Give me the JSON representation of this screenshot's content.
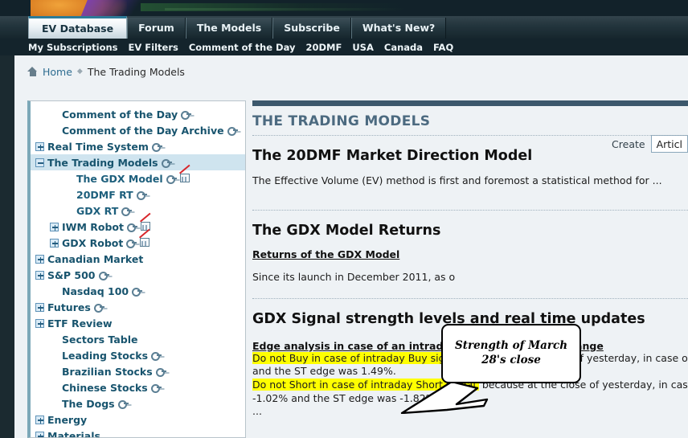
{
  "banner": {
    "name": "site-banner"
  },
  "tabs": [
    {
      "label": "EV Database",
      "active": true
    },
    {
      "label": "Forum",
      "active": false
    },
    {
      "label": "The Models",
      "active": false
    },
    {
      "label": "Subscribe",
      "active": false
    },
    {
      "label": "What's New?",
      "active": false
    }
  ],
  "subnav": [
    {
      "label": "My Subscriptions"
    },
    {
      "label": "EV Filters"
    },
    {
      "label": "Comment of the Day"
    },
    {
      "label": "20DMF"
    },
    {
      "label": "USA"
    },
    {
      "label": "Canada"
    },
    {
      "label": "FAQ"
    }
  ],
  "breadcrumb": {
    "home": "Home",
    "separator": "◆",
    "current": "The Trading Models"
  },
  "create_bar": {
    "label": "Create",
    "selected_option": "Articl"
  },
  "sidebar": {
    "items": [
      {
        "label": "Comment of the Day",
        "toggle": "none",
        "indent": 1,
        "key": true,
        "chart": false,
        "selected": false
      },
      {
        "label": "Comment of the Day Archive",
        "toggle": "none",
        "indent": 1,
        "key": true,
        "chart": false,
        "selected": false
      },
      {
        "label": "Real Time System",
        "toggle": "plus",
        "indent": 0,
        "key": true,
        "chart": false,
        "selected": false
      },
      {
        "label": "The Trading Models",
        "toggle": "minus",
        "indent": 0,
        "key": true,
        "chart": false,
        "selected": true
      },
      {
        "label": "The GDX Model",
        "toggle": "none",
        "indent": 2,
        "key": true,
        "chart": true,
        "selected": false
      },
      {
        "label": "20DMF RT",
        "toggle": "none",
        "indent": 2,
        "key": true,
        "chart": false,
        "selected": false
      },
      {
        "label": "GDX RT",
        "toggle": "none",
        "indent": 2,
        "key": true,
        "chart": false,
        "selected": false
      },
      {
        "label": "IWM Robot",
        "toggle": "plus",
        "indent": 1,
        "key": true,
        "chart": true,
        "selected": false
      },
      {
        "label": "GDX Robot",
        "toggle": "plus",
        "indent": 1,
        "key": true,
        "chart": true,
        "selected": false
      },
      {
        "label": "Canadian Market",
        "toggle": "plus",
        "indent": 0,
        "key": false,
        "chart": false,
        "selected": false
      },
      {
        "label": "S&P 500",
        "toggle": "plus",
        "indent": 0,
        "key": true,
        "chart": false,
        "selected": false
      },
      {
        "label": "Nasdaq 100",
        "toggle": "none",
        "indent": 1,
        "key": true,
        "chart": false,
        "selected": false
      },
      {
        "label": "Futures",
        "toggle": "plus",
        "indent": 0,
        "key": true,
        "chart": false,
        "selected": false
      },
      {
        "label": "ETF Review",
        "toggle": "plus",
        "indent": 0,
        "key": false,
        "chart": false,
        "selected": false
      },
      {
        "label": "Sectors Table",
        "toggle": "none",
        "indent": 1,
        "key": false,
        "chart": false,
        "selected": false
      },
      {
        "label": "Leading Stocks",
        "toggle": "none",
        "indent": 1,
        "key": true,
        "chart": false,
        "selected": false
      },
      {
        "label": "Brazilian Stocks",
        "toggle": "none",
        "indent": 1,
        "key": true,
        "chart": false,
        "selected": false
      },
      {
        "label": "Chinese Stocks",
        "toggle": "none",
        "indent": 1,
        "key": true,
        "chart": false,
        "selected": false
      },
      {
        "label": "The Dogs",
        "toggle": "none",
        "indent": 1,
        "key": true,
        "chart": false,
        "selected": false
      },
      {
        "label": "Energy",
        "toggle": "plus",
        "indent": 0,
        "key": false,
        "chart": false,
        "selected": false
      },
      {
        "label": "Materials",
        "toggle": "plus",
        "indent": 0,
        "key": false,
        "chart": false,
        "selected": false
      }
    ]
  },
  "content": {
    "section_title": "THE TRADING MODELS",
    "block1": {
      "heading": "The 20DMF Market Direction Model",
      "paragraph": "The Effective Volume (EV) method is first and foremost a statistical method for ..."
    },
    "block2": {
      "heading": "The GDX Model Returns",
      "link": "Returns of the GDX Model",
      "paragraph": "Since its launch in December 2011, as o"
    },
    "block3": {
      "heading": "GDX Signal strength levels and real time updates",
      "subhead": "Edge analysis in case of an intraday real time GDX MF change",
      "line1_hl": "Do not Buy in case of intraday Buy signal,",
      "line1_rest": " because at the close of yesterday, in case of a Buy signal",
      "line2": "and the ST edge was 1.49%.",
      "line3_hl": "Do not Short in case of intraday Short signal,",
      "line3_rest": " because at the close of yesterday, in case of a Short",
      "line4": "-1.02% and the ST edge was -1.82%.",
      "ellipsis": "..."
    }
  },
  "callout": {
    "text": "Strength of March 28's close"
  },
  "colors": {
    "accent": "#2d7b98",
    "header_dark": "#14242c",
    "page_bg": "#eef2f5",
    "nav_text": "#18546e",
    "selected_row": "#cfe4ef",
    "highlight": "#ffff00",
    "content_topbar": "#3c586c"
  }
}
